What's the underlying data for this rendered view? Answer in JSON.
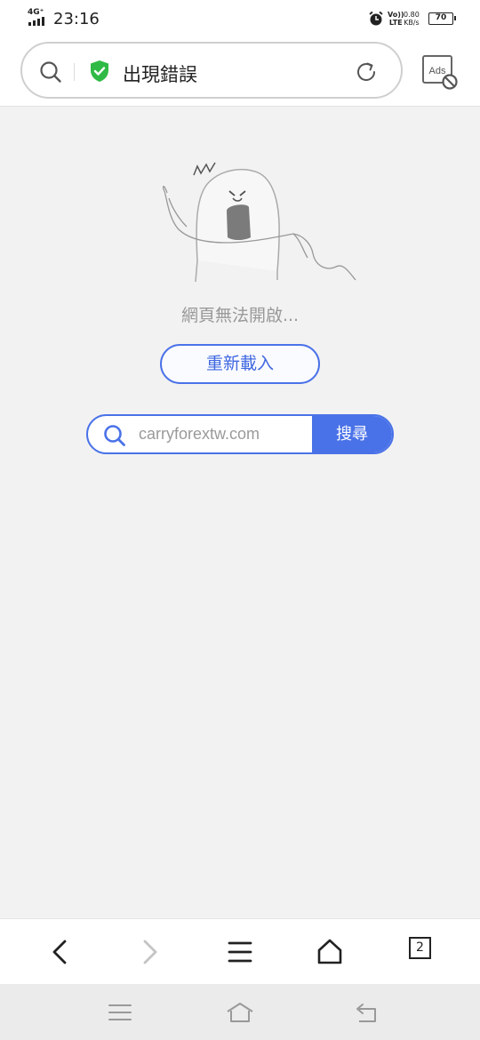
{
  "status_bar": {
    "network": "4G⁺",
    "time": "23:16",
    "volte": [
      "Vo))",
      "LTE"
    ],
    "speed": [
      "0.80",
      "KB/s"
    ],
    "battery": "70"
  },
  "address_bar": {
    "title": "出現錯誤",
    "ads_label": "Ads"
  },
  "error_page": {
    "message": "網頁無法開啟...",
    "reload_label": "重新載入",
    "search_placeholder": "carryforextw.com",
    "search_button": "搜尋"
  },
  "toolbar": {
    "tab_count": "2"
  },
  "colors": {
    "accent": "#4a72e8",
    "shield": "#2fba45"
  }
}
